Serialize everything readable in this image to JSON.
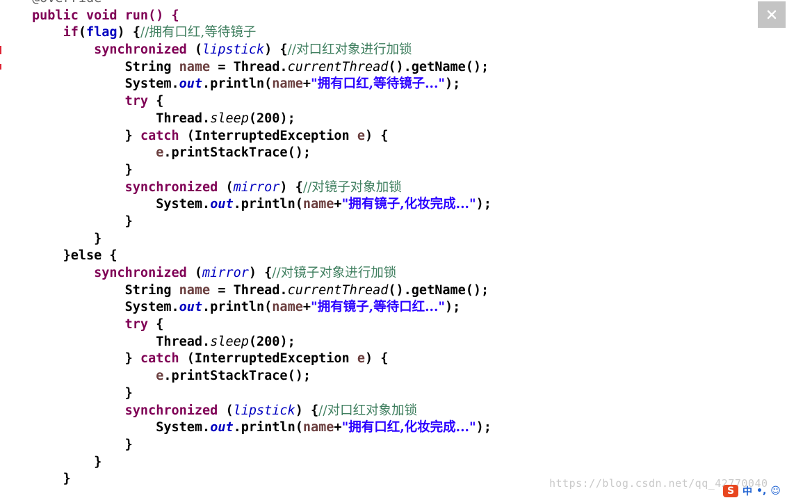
{
  "code": {
    "annotation": "@Override",
    "run_signature": "public void run() {",
    "if_kw": "if",
    "if_cond_open": "(",
    "flag": "flag",
    "if_cond_close": ") {",
    "comment_hold_lipstick": "//拥有口红,等待镜子",
    "sync_kw": "synchronized",
    "lipstick": "lipstick",
    "mirror": "mirror",
    "comment_lock_lipstick_go": "//对口红对象进行加锁",
    "comment_lock_mirror_go": "//对镜子对象进行加锁",
    "comment_lock_mirror": "//对镜子对象加锁",
    "comment_lock_lipstick": "//对口红对象加锁",
    "string_type": "String ",
    "name_var": "name",
    "assign_thread": " = Thread.",
    "current_thread": "currentThread",
    "get_name": "().getName();",
    "system": "System.",
    "out": "out",
    "println_open": ".println(",
    "plus": "+",
    "str_lipstick_wait": "\"拥有口红,等待镜子...\"",
    "str_mirror_done": "\"拥有镜子,化妆完成...\"",
    "str_mirror_wait": "\"拥有镜子,等待口红...\"",
    "str_lipstick_done": "\"拥有口红,化妆完成...\"",
    "println_close": ");",
    "try_kw": "try",
    "open_brace": " {",
    "thread_dot": "Thread.",
    "sleep": "sleep",
    "sleep_arg": "(200);",
    "close_brace": "}",
    "catch_kw": "catch",
    "catch_open": " (InterruptedException ",
    "e_var": "e",
    "catch_close": ") {",
    "print_stack": ".printStackTrace();",
    "else_line": "}else {",
    "sp": " ",
    "paren_open": "(",
    "paren_close_brace": ") {"
  },
  "window": {
    "close_icon": "close-icon"
  },
  "watermark": "https://blog.csdn.net/qq_42770040",
  "ime": {
    "logo": "S",
    "lang": "中",
    "punct": "•,",
    "emoji": "☺"
  },
  "colors": {
    "keyword": "#7f0055",
    "string": "#2a00ff",
    "comment": "#3f7f5f",
    "field": "#0000c0",
    "local_var": "#6a3e3e",
    "annotation": "#646464"
  }
}
